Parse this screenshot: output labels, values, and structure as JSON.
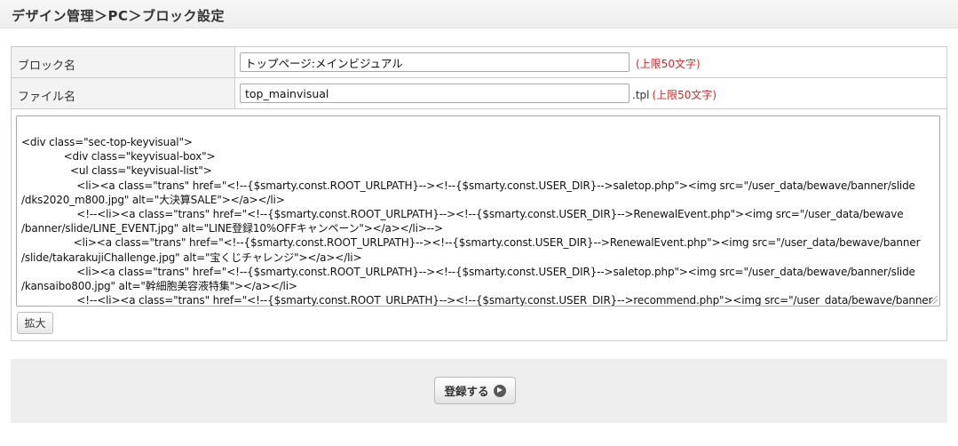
{
  "header": {
    "title": "デザイン管理＞PC＞ブロック設定"
  },
  "form": {
    "block_name": {
      "label": "ブロック名",
      "value": "トップページ:メインビジュアル",
      "limit_note": "(上限50文字)"
    },
    "file_name": {
      "label": "ファイル名",
      "value": "top_mainvisual",
      "extension": ".tpl",
      "limit_note": "(上限50文字)"
    },
    "code": "<div class=\"sec-top-keyvisual\">\n             <div class=\"keyvisual-box\">\n               <ul class=\"keyvisual-list\">\n                 <li><a class=\"trans\" href=\"<!--{$smarty.const.ROOT_URLPATH}--><!--{$smarty.const.USER_DIR}-->saletop.php\"><img src=\"/user_data/bewave/banner/slide\n/dks2020_m800.jpg\" alt=\"大決算SALE\"></a></li>\n                 <!--<li><a class=\"trans\" href=\"<!--{$smarty.const.ROOT_URLPATH}--><!--{$smarty.const.USER_DIR}-->RenewalEvent.php\"><img src=\"/user_data/bewave\n/banner/slide/LINE_EVENT.jpg\" alt=\"LINE登録10%OFFキャンペーン\"></a></li>-->\n                <li><a class=\"trans\" href=\"<!--{$smarty.const.ROOT_URLPATH}--><!--{$smarty.const.USER_DIR}-->RenewalEvent.php\"><img src=\"/user_data/bewave/banner\n/slide/takarakujiChallenge.jpg\" alt=\"宝くじチャレンジ\"></a></li>\n                 <li><a class=\"trans\" href=\"<!--{$smarty.const.ROOT_URLPATH}--><!--{$smarty.const.USER_DIR}-->saletop.php\"><img src=\"/user_data/bewave/banner/slide\n/kansaibo800.jpg\" alt=\"幹細胞美容液特集\"></a></li>\n                 <!--<li><a class=\"trans\" href=\"<!--{$smarty.const.ROOT_URLPATH}--><!--{$smarty.const.USER_DIR}-->recommend.php\"><img src=\"/user_data/bewave/banner",
    "expand_label": "拡大"
  },
  "footer": {
    "submit_label": "登録する"
  },
  "icons": {
    "submit_icon": "arrow-circle-icon"
  }
}
